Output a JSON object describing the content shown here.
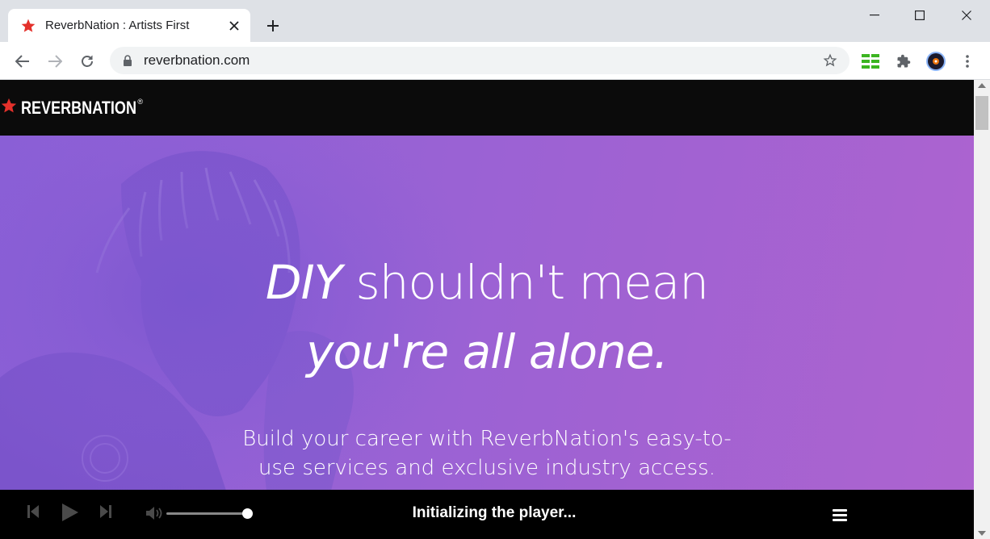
{
  "browser": {
    "tab": {
      "title": "ReverbNation : Artists First"
    },
    "address": {
      "url": "reverbnation.com"
    }
  },
  "site": {
    "brand": {
      "logo_text": "REVERBNATION",
      "reg_mark": "®"
    },
    "hero": {
      "headline_line1_em": "DIY",
      "headline_line1_rest": " shouldn't mean",
      "headline_line2": "you're all alone.",
      "sub_line1": "Build your career with ReverbNation's easy-to-",
      "sub_line2": "use services and exclusive industry access."
    },
    "player": {
      "status": "Initializing the player...",
      "volume_level": 1.0
    }
  },
  "colors": {
    "brand_red": "#e4312b",
    "hero_start": "#8a5fd6",
    "hero_end": "#ad63cf",
    "header_bg": "#0b0b0b"
  }
}
